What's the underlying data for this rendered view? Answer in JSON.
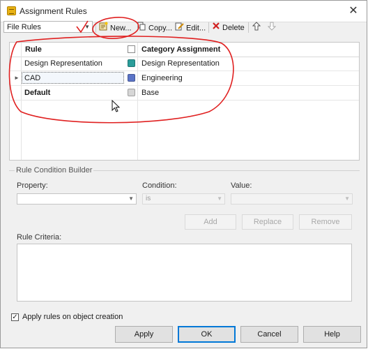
{
  "window": {
    "title": "Assignment Rules",
    "close_glyph": "✕"
  },
  "toolbar": {
    "rules_type": {
      "value": "File Rules"
    },
    "buttons": [
      {
        "label": "New..."
      },
      {
        "label": "Copy..."
      },
      {
        "label": "Edit..."
      },
      {
        "label": "Delete"
      }
    ]
  },
  "grid": {
    "columns": [
      "Rule",
      "Category Assignment"
    ],
    "rows": [
      {
        "rule": "Design Representation",
        "category": "Design Representation",
        "color": "#2a9d9a",
        "bold": false
      },
      {
        "rule": "CAD",
        "category": "Engineering",
        "color": "#5b74c7",
        "bold": false,
        "selected": true
      },
      {
        "rule": "Default",
        "category": "Base",
        "color": "#d6d6d6",
        "bold": true
      }
    ]
  },
  "builder": {
    "title": "Rule Condition Builder",
    "property_label": "Property:",
    "condition_label": "Condition:",
    "condition_value": "is",
    "value_label": "Value:",
    "buttons": {
      "add": "Add",
      "replace": "Replace",
      "remove": "Remove"
    },
    "criteria_label": "Rule Criteria:"
  },
  "footer": {
    "apply_on_creation": {
      "label": "Apply rules on object creation",
      "checked": true
    },
    "buttons": {
      "apply": "Apply",
      "ok": "OK",
      "cancel": "Cancel",
      "help": "Help"
    }
  },
  "annotation_color": "#e02020"
}
